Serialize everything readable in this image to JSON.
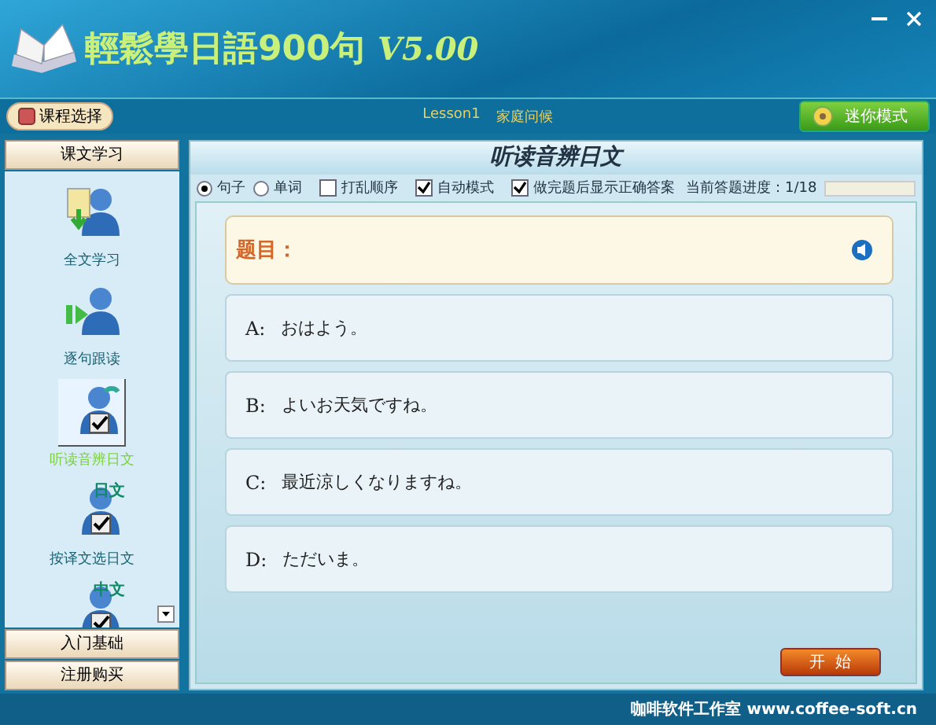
{
  "window": {
    "title": "輕鬆學日語900句",
    "version": "V5.00"
  },
  "toolbar": {
    "course_button": "课程选择",
    "lesson": "Lesson1",
    "lesson_title": "家庭问候",
    "mini_button": "迷你模式"
  },
  "sidebar": {
    "sections": [
      {
        "label": "课文学习"
      },
      {
        "label": "入门基础"
      },
      {
        "label": "注册购买"
      }
    ],
    "items": [
      {
        "kind": "fulltext",
        "label": "全文学习",
        "selected": false
      },
      {
        "kind": "follow",
        "label": "逐句跟读",
        "selected": false
      },
      {
        "kind": "listen",
        "label": "听读音辨日文",
        "selected": true
      },
      {
        "kind": "jp",
        "badge": "日文",
        "label": "按译文选日文",
        "selected": false
      },
      {
        "kind": "cn",
        "badge": "中文",
        "selected": false
      }
    ]
  },
  "panel": {
    "title": "听读音辨日文",
    "modes": [
      {
        "label": "句子",
        "selected": true
      },
      {
        "label": "单词",
        "selected": false
      }
    ],
    "options": [
      {
        "label": "打乱顺序",
        "checked": false
      },
      {
        "label": "自动模式",
        "checked": true
      },
      {
        "label": "做完题后显示正确答案",
        "checked": true
      }
    ],
    "progress_label": "当前答题进度：1/18",
    "question_label": "题目：",
    "answers": [
      {
        "letter": "A:",
        "text": "おはよう。"
      },
      {
        "letter": "B:",
        "text": "よいお天気ですね。"
      },
      {
        "letter": "C:",
        "text": "最近涼しくなりますね。"
      },
      {
        "letter": "D:",
        "text": "ただいま。"
      }
    ],
    "start_button": "开  始"
  },
  "footer": "咖啡软件工作室 www.coffee-soft.cn"
}
